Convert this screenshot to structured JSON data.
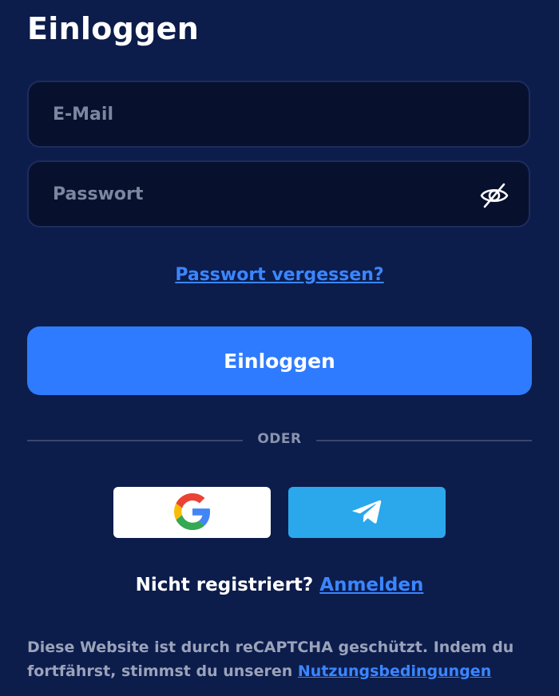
{
  "page": {
    "title": "Einloggen"
  },
  "form": {
    "email_placeholder": "E-Mail",
    "password_placeholder": "Passwort",
    "password_toggle_icon": "eye-off-icon",
    "forgot_password": "Passwort vergessen?",
    "submit_label": "Einloggen"
  },
  "divider": {
    "label": "ODER"
  },
  "social": {
    "google_icon": "google-icon",
    "telegram_icon": "telegram-icon"
  },
  "register": {
    "prompt": "Nicht registriert?",
    "link": "Anmelden"
  },
  "legal": {
    "text": "Diese Website ist durch reCAPTCHA geschützt. Indem du fortfährst, stimmst du unseren",
    "terms_link": "Nutzungsbedingungen"
  },
  "colors": {
    "background": "#0c1c4b",
    "input_background": "#07102d",
    "primary": "#2f7bff",
    "link": "#3b86ff",
    "telegram": "#2aa8eb"
  }
}
